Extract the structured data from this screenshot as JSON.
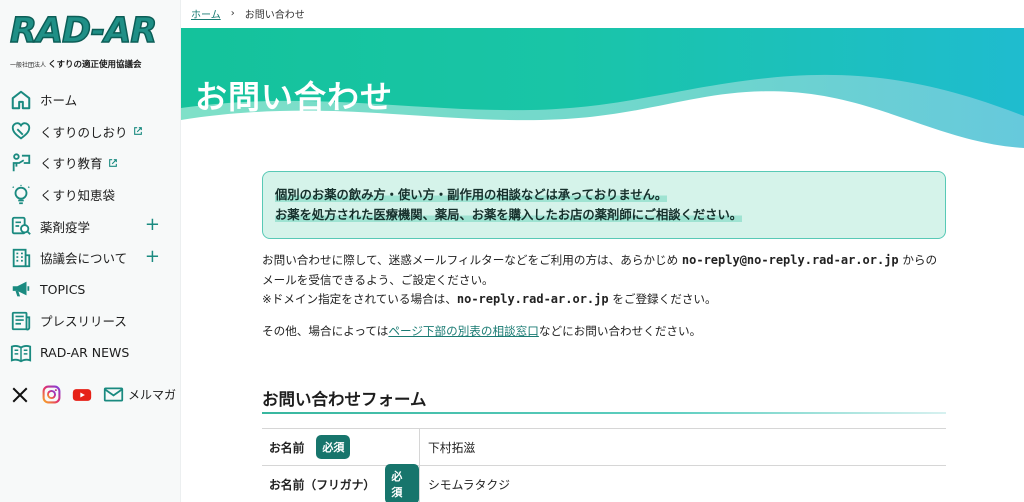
{
  "logo": {
    "main": "RAD-AR",
    "sub_prefix": "一般社団法人",
    "sub": "くすりの適正使用協議会"
  },
  "sidebar": {
    "items": [
      {
        "label": "ホーム",
        "icon": "home-icon",
        "external": false,
        "expand": false
      },
      {
        "label": "くすりのしおり",
        "icon": "pill-heart-icon",
        "external": true,
        "expand": false
      },
      {
        "label": "くすり教育",
        "icon": "education-icon",
        "external": true,
        "expand": false
      },
      {
        "label": "くすり知恵袋",
        "icon": "lightbulb-icon",
        "external": false,
        "expand": false
      },
      {
        "label": "薬剤疫学",
        "icon": "epidemiology-icon",
        "external": false,
        "expand": true
      },
      {
        "label": "協議会について",
        "icon": "building-icon",
        "external": false,
        "expand": true
      },
      {
        "label": "TOPICS",
        "icon": "megaphone-icon",
        "external": false,
        "expand": false
      },
      {
        "label": "プレスリリース",
        "icon": "press-icon",
        "external": false,
        "expand": false
      },
      {
        "label": "RAD-AR NEWS",
        "icon": "news-icon",
        "external": false,
        "expand": false
      }
    ],
    "plus_symbol": "+",
    "mail_label": "メルマガ"
  },
  "breadcrumb": {
    "home": "ホーム",
    "separator": "›",
    "current": "お問い合わせ"
  },
  "hero": {
    "title": "お問い合わせ"
  },
  "notice": {
    "line1": "個別のお薬の飲み方・使い方・副作用の相談などは承っておりません。",
    "line2": "お薬を処方された医療機関、薬局、お薬を購入したお店の薬剤師にご相談ください。"
  },
  "body": {
    "p1_a": "お問い合わせに際して、迷惑メールフィルターなどをご利用の方は、あらかじめ ",
    "p1_email": "no-reply@no-reply.rad-ar.or.jp",
    "p1_b": " からのメールを受信できるよう、ご設定ください。",
    "p1_c": "※ドメイン指定をされている場合は、",
    "p1_domain": "no-reply.rad-ar.or.jp",
    "p1_d": " をご登録ください。",
    "p2_a": "その他、場合によっては",
    "p2_link": "ページ下部の別表の相談窓口",
    "p2_b": "などにお問い合わせください。"
  },
  "form": {
    "title": "お問い合わせフォーム",
    "required_label": "必須",
    "rows": [
      {
        "label": "お名前",
        "value": "下村拓滋"
      },
      {
        "label": "お名前（フリガナ）",
        "value": "シモムラタクジ"
      }
    ]
  },
  "colors": {
    "accent": "#17756c",
    "hero_start": "#16c3a0",
    "hero_end": "#2db4d6"
  }
}
